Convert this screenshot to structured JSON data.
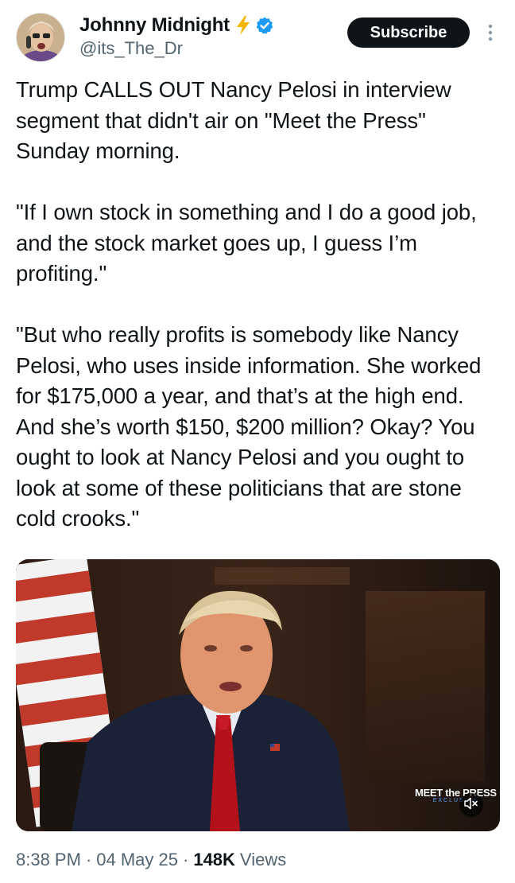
{
  "author": {
    "display_name": "Johnny Midnight",
    "handle": "@its_The_Dr",
    "badges": [
      "lightning-bolt-icon",
      "verified-badge-icon"
    ],
    "verified_color": "#1d9bf0",
    "bolt_color": "#f5b400"
  },
  "actions": {
    "subscribe_label": "Subscribe",
    "more_icon": "more-vertical-icon"
  },
  "post": {
    "text": "Trump CALLS OUT Nancy Pelosi in interview segment that didn't air on \"Meet the Press\" Sunday morning.\n\n\"If I own stock in something and I do a good job, and the stock market goes up, I guess I’m profiting.\"\n\n\"But who really profits is somebody like Nancy Pelosi, who uses inside information. She worked for $175,000 a year, and that’s at the high end. And she’s worth $150, $200 million? Okay? You ought to look at Nancy Pelosi and you ought to look at some of these politicians that are stone cold crooks.\""
  },
  "media": {
    "type": "video",
    "watermark_title": "MEET the PRESS",
    "watermark_sub": "EXCLUSIVE",
    "mute_icon": "speaker-muted-icon"
  },
  "meta": {
    "time": "8:38 PM",
    "separator": "·",
    "date": "04 May 25",
    "views_count": "148K",
    "views_label": "Views"
  },
  "colors": {
    "text_primary": "#0f1419",
    "text_secondary": "#536471",
    "button_bg": "#0f1419",
    "button_text": "#ffffff"
  }
}
